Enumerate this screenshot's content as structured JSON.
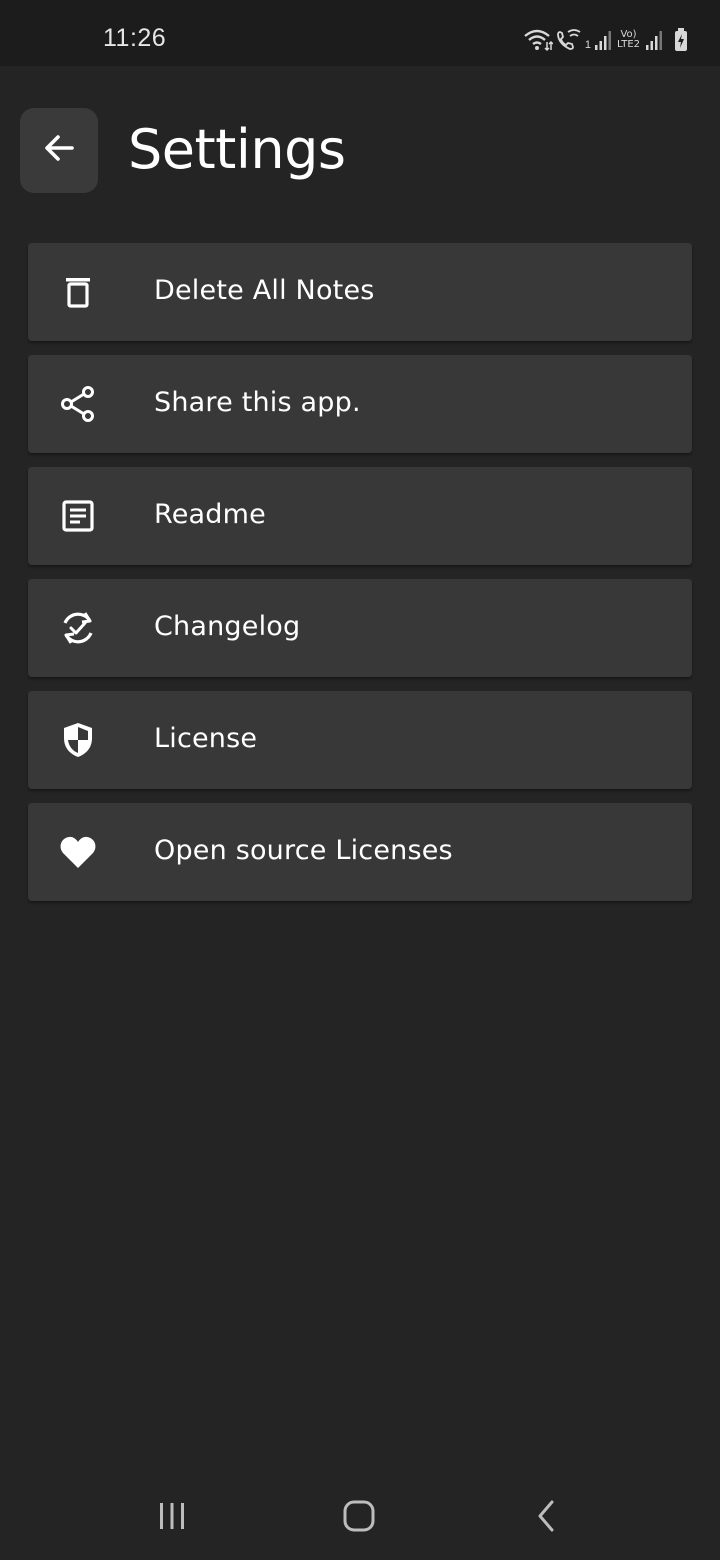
{
  "status_bar": {
    "time": "11:26",
    "volte_top": "Vo)",
    "volte_bottom": "LTE2",
    "sim1_label": "1"
  },
  "header": {
    "title": "Settings",
    "back_icon": "arrow-left-icon"
  },
  "menu": {
    "items": [
      {
        "label": "Delete All Notes",
        "icon": "trash-icon"
      },
      {
        "label": "Share this app.",
        "icon": "share-icon"
      },
      {
        "label": "Readme",
        "icon": "document-icon"
      },
      {
        "label": "Changelog",
        "icon": "sync-check-icon"
      },
      {
        "label": "License",
        "icon": "shield-icon"
      },
      {
        "label": "Open source Licenses",
        "icon": "heart-icon"
      }
    ]
  },
  "nav_bar": {
    "recents_icon": "recents-icon",
    "home_icon": "home-icon",
    "back_icon": "back-chevron-icon"
  },
  "colors": {
    "background": "#242424",
    "status_bar": "#1c1c1c",
    "card": "#383838",
    "back_button": "#3a3a3a",
    "text": "#ffffff"
  }
}
